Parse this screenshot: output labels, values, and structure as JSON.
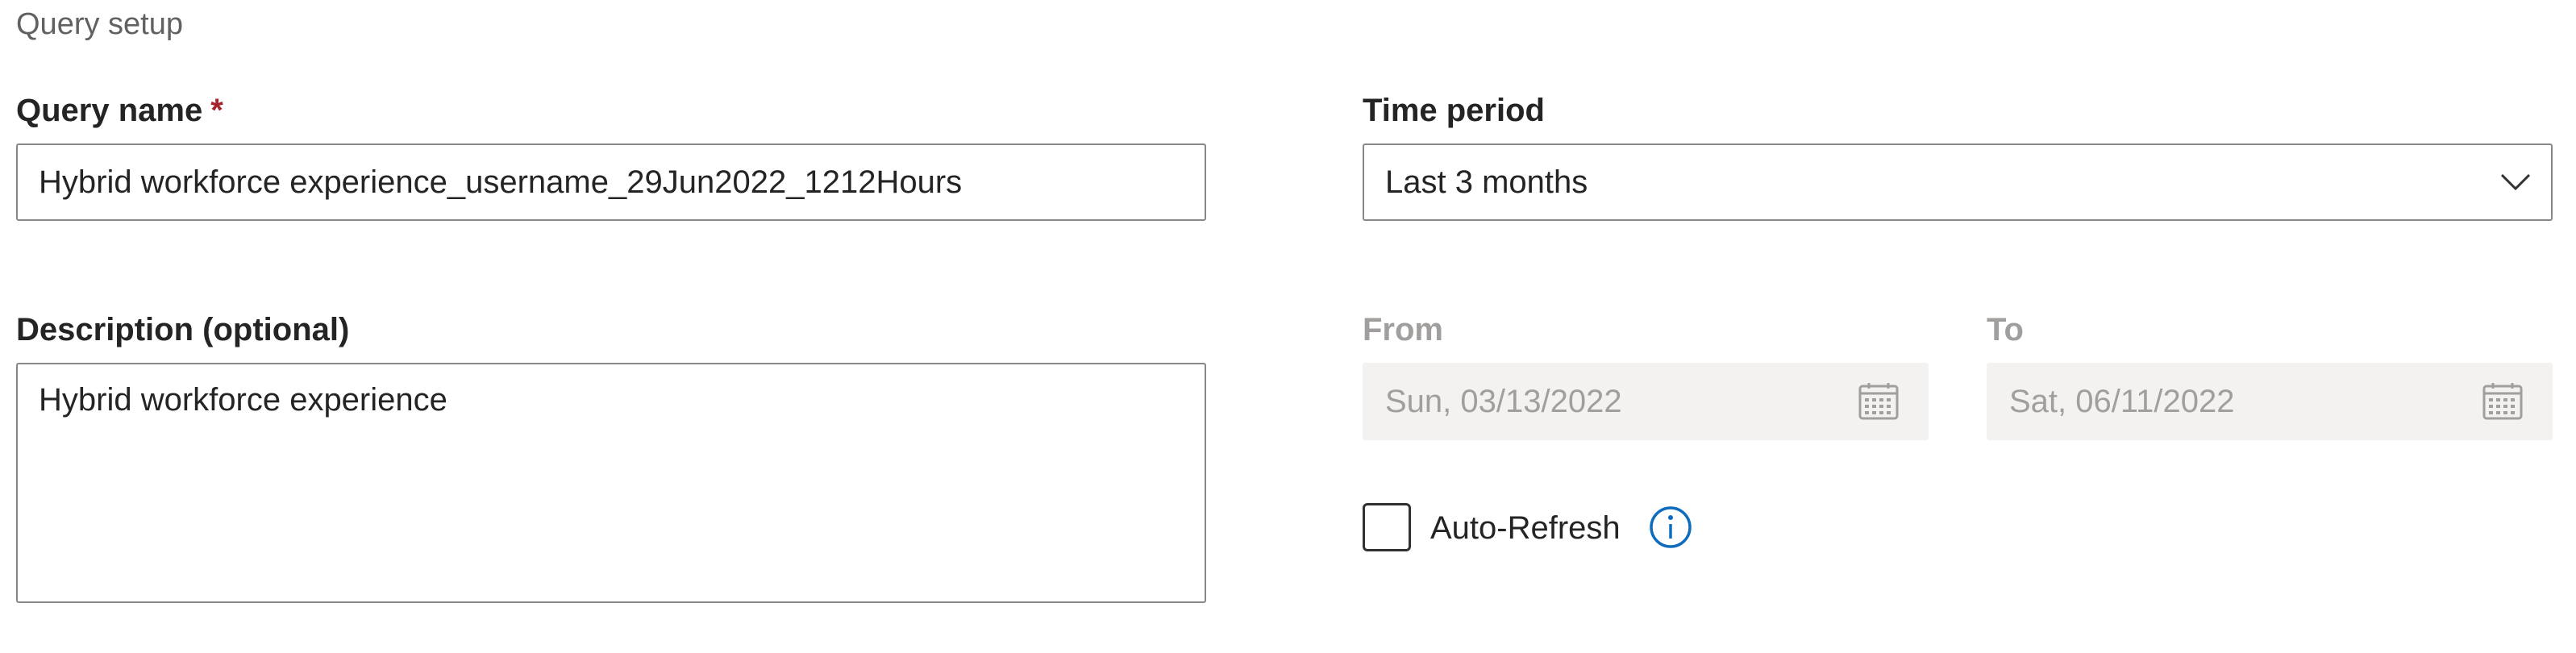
{
  "section": {
    "title": "Query setup"
  },
  "query_name": {
    "label": "Query name",
    "required_mark": "*",
    "value": "Hybrid workforce experience_username_29Jun2022_1212Hours"
  },
  "description": {
    "label": "Description (optional)",
    "value": "Hybrid workforce experience"
  },
  "time_period": {
    "label": "Time period",
    "selected": "Last 3 months",
    "icon": "chevron-down-icon"
  },
  "from": {
    "label": "From",
    "value": "Sun, 03/13/2022",
    "icon": "calendar-icon"
  },
  "to": {
    "label": "To",
    "value": "Sat, 06/11/2022",
    "icon": "calendar-icon"
  },
  "auto_refresh": {
    "label": "Auto-Refresh",
    "checked": false,
    "icon": "info-icon"
  },
  "colors": {
    "required": "#a4262c",
    "border": "#8a8886",
    "disabled_bg": "#f3f2f1",
    "disabled_text": "#a19f9d",
    "info_accent": "#0f6cbd"
  }
}
